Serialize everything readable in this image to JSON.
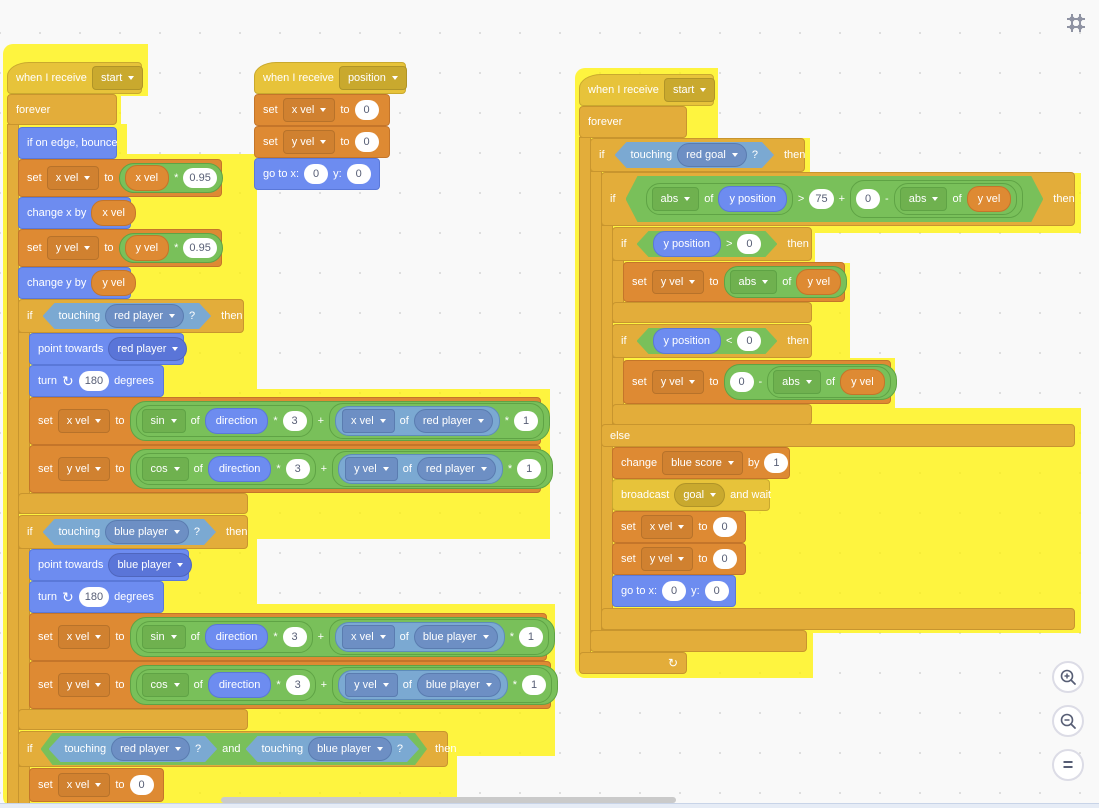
{
  "workspace": {
    "scripts": [
      {
        "id": "script1",
        "hat": {
          "label": "when I receive",
          "message": "start"
        },
        "forever_label": "forever",
        "blocks": {
          "bounce": "if on edge, bounce",
          "set_x1": {
            "label": "set",
            "var": "x vel",
            "to": "to",
            "rep": "x vel",
            "op": "*",
            "val": "0.95"
          },
          "change_x": {
            "label": "change x by",
            "rep": "x vel"
          },
          "set_y1": {
            "label": "set",
            "var": "y vel",
            "to": "to",
            "rep": "y vel",
            "op": "*",
            "val": "0.95"
          },
          "change_y": {
            "label": "change y by",
            "rep": "y vel"
          },
          "if_red": {
            "if": "if",
            "touching": "touching",
            "target": "red player",
            "q": "?",
            "then": "then"
          },
          "point_red": {
            "label": "point towards",
            "target": "red player"
          },
          "turn_red": {
            "label": "turn",
            "val": "180",
            "unit": "degrees"
          },
          "set_x_red": {
            "label": "set",
            "var": "x vel",
            "to": "to",
            "fn": "sin",
            "of": "of",
            "rep": "direction",
            "mul": "*",
            "k": "3",
            "plus": "+",
            "attr": "x vel",
            "sprite": "red player",
            "mul2": "*",
            "k2": "1"
          },
          "set_y_red": {
            "label": "set",
            "var": "y vel",
            "to": "to",
            "fn": "cos",
            "of": "of",
            "rep": "direction",
            "mul": "*",
            "k": "3",
            "plus": "+",
            "attr": "y vel",
            "sprite": "red player",
            "mul2": "*",
            "k2": "1"
          },
          "if_blue": {
            "if": "if",
            "touching": "touching",
            "target": "blue player",
            "q": "?",
            "then": "then"
          },
          "point_blue": {
            "label": "point towards",
            "target": "blue player"
          },
          "turn_blue": {
            "label": "turn",
            "val": "180",
            "unit": "degrees"
          },
          "set_x_blue": {
            "label": "set",
            "var": "x vel",
            "to": "to",
            "fn": "sin",
            "of": "of",
            "rep": "direction",
            "mul": "*",
            "k": "3",
            "plus": "+",
            "attr": "x vel",
            "sprite": "blue player",
            "mul2": "*",
            "k2": "1"
          },
          "set_y_blue": {
            "label": "set",
            "var": "y vel",
            "to": "to",
            "fn": "cos",
            "of": "of",
            "rep": "direction",
            "mul": "*",
            "k": "3",
            "plus": "+",
            "attr": "y vel",
            "sprite": "blue player",
            "mul2": "*",
            "k2": "1"
          },
          "if_both": {
            "if": "if",
            "touching": "touching",
            "target1": "red player",
            "q": "?",
            "and": "and",
            "target2": "blue player",
            "then": "then"
          },
          "set_x0": {
            "label": "set",
            "var": "x vel",
            "to": "to",
            "val": "0"
          }
        }
      },
      {
        "id": "script2",
        "hat": {
          "label": "when I receive",
          "message": "position"
        },
        "blocks": {
          "set_x": {
            "label": "set",
            "var": "x vel",
            "to": "to",
            "val": "0"
          },
          "set_y": {
            "label": "set",
            "var": "y vel",
            "to": "to",
            "val": "0"
          },
          "goto": {
            "label": "go to x:",
            "x": "0",
            "ylabel": "y:",
            "y": "0"
          }
        }
      },
      {
        "id": "script3",
        "hat": {
          "label": "when I receive",
          "message": "start"
        },
        "forever_label": "forever",
        "blocks": {
          "if_goal": {
            "if": "if",
            "touching": "touching",
            "target": "red goal",
            "q": "?",
            "then": "then"
          },
          "if_abs": {
            "if": "if",
            "fn1": "abs",
            "of": "of",
            "rep1": "y position",
            "gt": ">",
            "v1": "75",
            "plus": "+",
            "v2": "0",
            "minus": "-",
            "fn2": "abs",
            "rep2": "y vel",
            "then": "then"
          },
          "if_pos": {
            "if": "if",
            "rep": "y position",
            "gt": ">",
            "val": "0",
            "then": "then"
          },
          "set_y_abs": {
            "label": "set",
            "var": "y vel",
            "to": "to",
            "fn": "abs",
            "of": "of",
            "rep": "y vel"
          },
          "if_neg": {
            "if": "if",
            "rep": "y position",
            "lt": "<",
            "val": "0",
            "then": "then"
          },
          "set_y_neg": {
            "label": "set",
            "var": "y vel",
            "to": "to",
            "val": "0",
            "minus": "-",
            "fn": "abs",
            "of": "of",
            "rep": "y vel"
          },
          "else": "else",
          "change_score": {
            "label": "change",
            "var": "blue score",
            "by": "by",
            "val": "1"
          },
          "broadcast": {
            "label": "broadcast",
            "msg": "goal",
            "wait": "and wait"
          },
          "set_x": {
            "label": "set",
            "var": "x vel",
            "to": "to",
            "val": "0"
          },
          "set_y": {
            "label": "set",
            "var": "y vel",
            "to": "to",
            "val": "0"
          },
          "goto": {
            "label": "go to x:",
            "x": "0",
            "ylabel": "y:",
            "y": "0"
          },
          "loop_arrow": "↻"
        }
      }
    ]
  },
  "controls": {
    "cleanup_icon": "cleanup-icon",
    "zoom_in": "zoom-in-icon",
    "zoom_out": "zoom-out-icon",
    "reset": "="
  }
}
